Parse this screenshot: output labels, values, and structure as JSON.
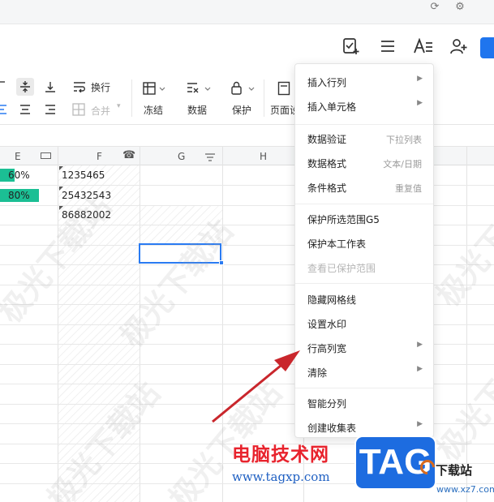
{
  "ribbon": {
    "wrap_label": "换行",
    "merge_label": "合并",
    "freeze_label": "冻结",
    "data_label": "数据",
    "protect_label": "保护",
    "page_label": "页面设"
  },
  "columns": [
    "E",
    "F",
    "G",
    "H"
  ],
  "cells": {
    "e1": "60%",
    "e2": "80%",
    "f1": "1235465",
    "f2": "25432543",
    "f3": "86882002"
  },
  "progress": {
    "e1": 0.6,
    "e2": 0.8
  },
  "colors": {
    "accent": "#1f75ee",
    "bar": "#1bbf94",
    "selection": "#2a7bf2",
    "arrow": "#c9262c"
  },
  "menu": {
    "group1": [
      {
        "label": "插入行列",
        "submenu": true
      },
      {
        "label": "插入单元格",
        "submenu": true
      }
    ],
    "group2": [
      {
        "label": "数据验证",
        "shortcut": "下拉列表"
      },
      {
        "label": "数据格式",
        "shortcut": "文本/日期"
      },
      {
        "label": "条件格式",
        "shortcut": "重复值"
      }
    ],
    "group3": [
      {
        "label": "保护所选范围G5"
      },
      {
        "label": "保护本工作表"
      },
      {
        "label": "查看已保护范围",
        "disabled": true
      }
    ],
    "group4": [
      {
        "label": "隐藏网格线"
      },
      {
        "label": "设置水印"
      },
      {
        "label": "行高列宽",
        "submenu": true
      },
      {
        "label": "清除",
        "submenu": true
      }
    ],
    "group5": [
      {
        "label": "智能分列"
      },
      {
        "label": "创建收集表",
        "submenu": true
      }
    ]
  },
  "watermark": "极光下载站",
  "overlay": {
    "site_name": "电脑技术网",
    "site_url": "www.tagxp.com",
    "tag_logo": "TAG",
    "xz_name": "下载站",
    "xz_url": "www.xz7.com"
  },
  "icons": [
    "sync-icon",
    "settings-icon",
    "add-task-icon",
    "menu-icon",
    "text-format-icon",
    "add-user-icon",
    "phone-icon",
    "filter-icon"
  ]
}
